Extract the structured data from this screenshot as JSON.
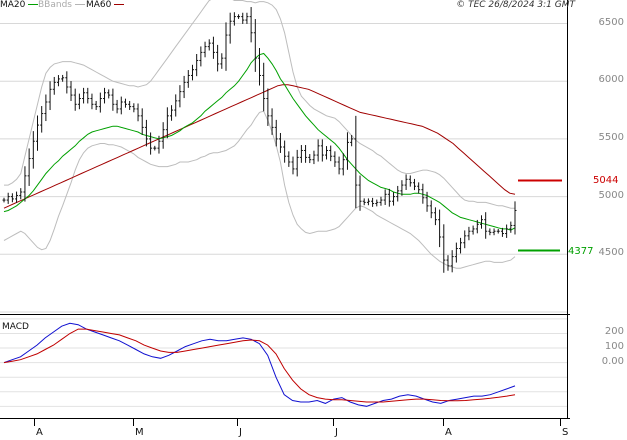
{
  "copyright": "© TEC 26/8/2024 3:1 GMT",
  "legend": [
    {
      "label": "MA20",
      "color": "#00a000"
    },
    {
      "label": "BBands",
      "color": "#b5b5b5"
    },
    {
      "label": "MA60",
      "color": "#a00000"
    }
  ],
  "macd_title": "MACD",
  "levels": {
    "resistance": {
      "value": "5044",
      "color": "#cc0000"
    },
    "support": {
      "value": "4377",
      "color": "#00a000"
    }
  },
  "chart_data": {
    "type": "line",
    "title": "",
    "price_ylim": [
      4000,
      6600
    ],
    "price_ticks": [
      "4500",
      "5000",
      "5500",
      "6000",
      "6500"
    ],
    "x_ticks": [
      "A",
      "M",
      "J",
      "J",
      "A",
      "S"
    ],
    "macd_ticks": [
      "200",
      "100",
      "0.00"
    ],
    "macd_ylim": [
      -380,
      320
    ],
    "grid": true,
    "price": [
      4970,
      5000,
      4980,
      5010,
      5040,
      5180,
      5330,
      5480,
      5620,
      5720,
      5820,
      5930,
      5990,
      6020,
      6030,
      5950,
      5880,
      5800,
      5850,
      5900,
      5850,
      5800,
      5780,
      5850,
      5900,
      5880,
      5800,
      5760,
      5820,
      5800,
      5780,
      5760,
      5700,
      5600,
      5500,
      5420,
      5420,
      5480,
      5580,
      5700,
      5750,
      5830,
      5910,
      5990,
      6050,
      6100,
      6180,
      6250,
      6300,
      6330,
      6250,
      6150,
      6200,
      6400,
      6520,
      6560,
      6560,
      6530,
      6560,
      6420,
      6200,
      6050,
      5850,
      5700,
      5600,
      5500,
      5430,
      5350,
      5300,
      5240,
      5340,
      5400,
      5340,
      5320,
      5360,
      5440,
      5360,
      5400,
      5350,
      5300,
      5240,
      5320,
      5470,
      5500,
      5100,
      4960,
      4950,
      4960,
      4940,
      4950,
      4970,
      5020,
      4960,
      5000,
      5050,
      5100,
      5150,
      5120,
      5090,
      5060,
      4990,
      4920,
      4860,
      4800,
      4650,
      4450,
      4400,
      4480,
      4550,
      4600,
      4660,
      4700,
      4720,
      4760,
      4800,
      4700,
      4690,
      4700,
      4700,
      4680,
      4720,
      4750,
      4880
    ],
    "ma20": [
      4870,
      4880,
      4900,
      4920,
      4950,
      4980,
      5010,
      5050,
      5100,
      5150,
      5200,
      5240,
      5280,
      5310,
      5350,
      5380,
      5410,
      5440,
      5480,
      5510,
      5540,
      5560,
      5570,
      5580,
      5590,
      5600,
      5610,
      5610,
      5600,
      5590,
      5580,
      5570,
      5560,
      5540,
      5530,
      5520,
      5510,
      5500,
      5510,
      5520,
      5530,
      5550,
      5570,
      5600,
      5620,
      5640,
      5670,
      5700,
      5740,
      5770,
      5800,
      5830,
      5860,
      5900,
      5930,
      5960,
      6000,
      6050,
      6100,
      6160,
      6200,
      6230,
      6240,
      6200,
      6150,
      6090,
      6020,
      5970,
      5910,
      5850,
      5800,
      5750,
      5700,
      5660,
      5620,
      5580,
      5550,
      5520,
      5490,
      5460,
      5420,
      5370,
      5320,
      5280,
      5240,
      5200,
      5170,
      5140,
      5120,
      5100,
      5080,
      5070,
      5060,
      5040,
      5030,
      5020,
      5020,
      5020,
      5030,
      5030,
      5020,
      5010,
      4990,
      4970,
      4950,
      4920,
      4890,
      4860,
      4840,
      4820,
      4810,
      4800,
      4790,
      4780,
      4770,
      4760,
      4750,
      4740,
      4730,
      4720,
      4720,
      4710,
      4730
    ],
    "bb_upper": [
      5100,
      5100,
      5120,
      5150,
      5200,
      5350,
      5500,
      5650,
      5800,
      5950,
      6070,
      6120,
      6150,
      6160,
      6170,
      6170,
      6170,
      6160,
      6150,
      6140,
      6120,
      6100,
      6080,
      6060,
      6040,
      6020,
      6000,
      5990,
      5980,
      5970,
      5960,
      5960,
      5950,
      5960,
      5970,
      6000,
      6050,
      6100,
      6150,
      6200,
      6250,
      6300,
      6350,
      6400,
      6450,
      6500,
      6550,
      6600,
      6650,
      6700,
      6720,
      6730,
      6740,
      6740,
      6720,
      6700,
      6700,
      6700,
      6690,
      6690,
      6680,
      6690,
      6690,
      6680,
      6660,
      6620,
      6540,
      6420,
      6250,
      6080,
      5950,
      5870,
      5830,
      5790,
      5760,
      5740,
      5720,
      5700,
      5690,
      5680,
      5650,
      5610,
      5570,
      5530,
      5490,
      5460,
      5440,
      5420,
      5400,
      5370,
      5350,
      5320,
      5290,
      5260,
      5230,
      5210,
      5200,
      5200,
      5210,
      5220,
      5230,
      5230,
      5220,
      5210,
      5190,
      5160,
      5120,
      5080,
      5040,
      5000,
      4970,
      4960,
      4960,
      4950,
      4950,
      4950,
      4940,
      4930,
      4920,
      4920,
      4910,
      4900,
      4900
    ],
    "bb_lower": [
      4620,
      4640,
      4660,
      4680,
      4700,
      4680,
      4640,
      4600,
      4560,
      4540,
      4550,
      4620,
      4720,
      4830,
      4920,
      5020,
      5120,
      5230,
      5320,
      5380,
      5420,
      5440,
      5450,
      5460,
      5460,
      5450,
      5450,
      5440,
      5430,
      5410,
      5390,
      5370,
      5340,
      5320,
      5300,
      5280,
      5270,
      5260,
      5260,
      5260,
      5270,
      5280,
      5300,
      5300,
      5300,
      5310,
      5320,
      5340,
      5350,
      5370,
      5380,
      5380,
      5390,
      5400,
      5420,
      5440,
      5480,
      5530,
      5580,
      5620,
      5680,
      5730,
      5740,
      5660,
      5560,
      5440,
      5300,
      5100,
      4950,
      4840,
      4760,
      4720,
      4690,
      4680,
      4690,
      4700,
      4700,
      4700,
      4710,
      4720,
      4740,
      4780,
      4820,
      4860,
      4900,
      4920,
      4910,
      4890,
      4870,
      4840,
      4820,
      4800,
      4780,
      4760,
      4740,
      4720,
      4700,
      4680,
      4650,
      4620,
      4580,
      4540,
      4500,
      4470,
      4440,
      4420,
      4400,
      4390,
      4380,
      4380,
      4390,
      4400,
      4410,
      4420,
      4430,
      4440,
      4440,
      4430,
      4430,
      4430,
      4440,
      4450,
      4480
    ],
    "ma60": [
      4900,
      4920,
      4940,
      4960,
      4980,
      5000,
      5020,
      5040,
      5060,
      5080,
      5100,
      5120,
      5140,
      5160,
      5180,
      5200,
      5220,
      5240,
      5260,
      5280,
      5300,
      5320,
      5340,
      5360,
      5380,
      5400,
      5420,
      5440,
      5460,
      5480,
      5500,
      5520,
      5540,
      5560,
      5580,
      5600,
      5620,
      5640,
      5660,
      5680,
      5700,
      5720,
      5740,
      5760,
      5780,
      5800,
      5820,
      5840,
      5860,
      5880,
      5900,
      5920,
      5940,
      5960,
      5970,
      5970,
      5960,
      5950,
      5940,
      5930,
      5910,
      5890,
      5870,
      5850,
      5830,
      5810,
      5790,
      5770,
      5750,
      5730,
      5720,
      5710,
      5700,
      5690,
      5680,
      5670,
      5660,
      5650,
      5640,
      5630,
      5620,
      5610,
      5590,
      5570,
      5550,
      5520,
      5490,
      5460,
      5420,
      5380,
      5340,
      5300,
      5260,
      5220,
      5180,
      5140,
      5100,
      5060,
      5030,
      5020
    ],
    "macd": [
      0,
      20,
      40,
      80,
      120,
      170,
      210,
      250,
      270,
      260,
      230,
      210,
      190,
      170,
      150,
      120,
      90,
      60,
      40,
      30,
      50,
      80,
      110,
      130,
      150,
      160,
      150,
      150,
      160,
      170,
      160,
      130,
      50,
      -100,
      -220,
      -260,
      -270,
      -270,
      -260,
      -280,
      -250,
      -240,
      -270,
      -290,
      -300,
      -280,
      -260,
      -250,
      -230,
      -220,
      -230,
      -250,
      -270,
      -280,
      -260,
      -250,
      -240,
      -230,
      -230,
      -220,
      -200,
      -180,
      -160
    ],
    "signal": [
      0,
      10,
      20,
      40,
      60,
      90,
      120,
      160,
      200,
      230,
      230,
      220,
      210,
      200,
      190,
      170,
      150,
      120,
      100,
      80,
      70,
      70,
      80,
      90,
      100,
      110,
      120,
      130,
      140,
      150,
      155,
      150,
      120,
      60,
      -40,
      -120,
      -180,
      -220,
      -240,
      -250,
      -255,
      -255,
      -260,
      -265,
      -270,
      -270,
      -270,
      -265,
      -260,
      -255,
      -250,
      -250,
      -255,
      -260,
      -262,
      -262,
      -260,
      -255,
      -250,
      -245,
      -238,
      -230,
      -220
    ]
  }
}
